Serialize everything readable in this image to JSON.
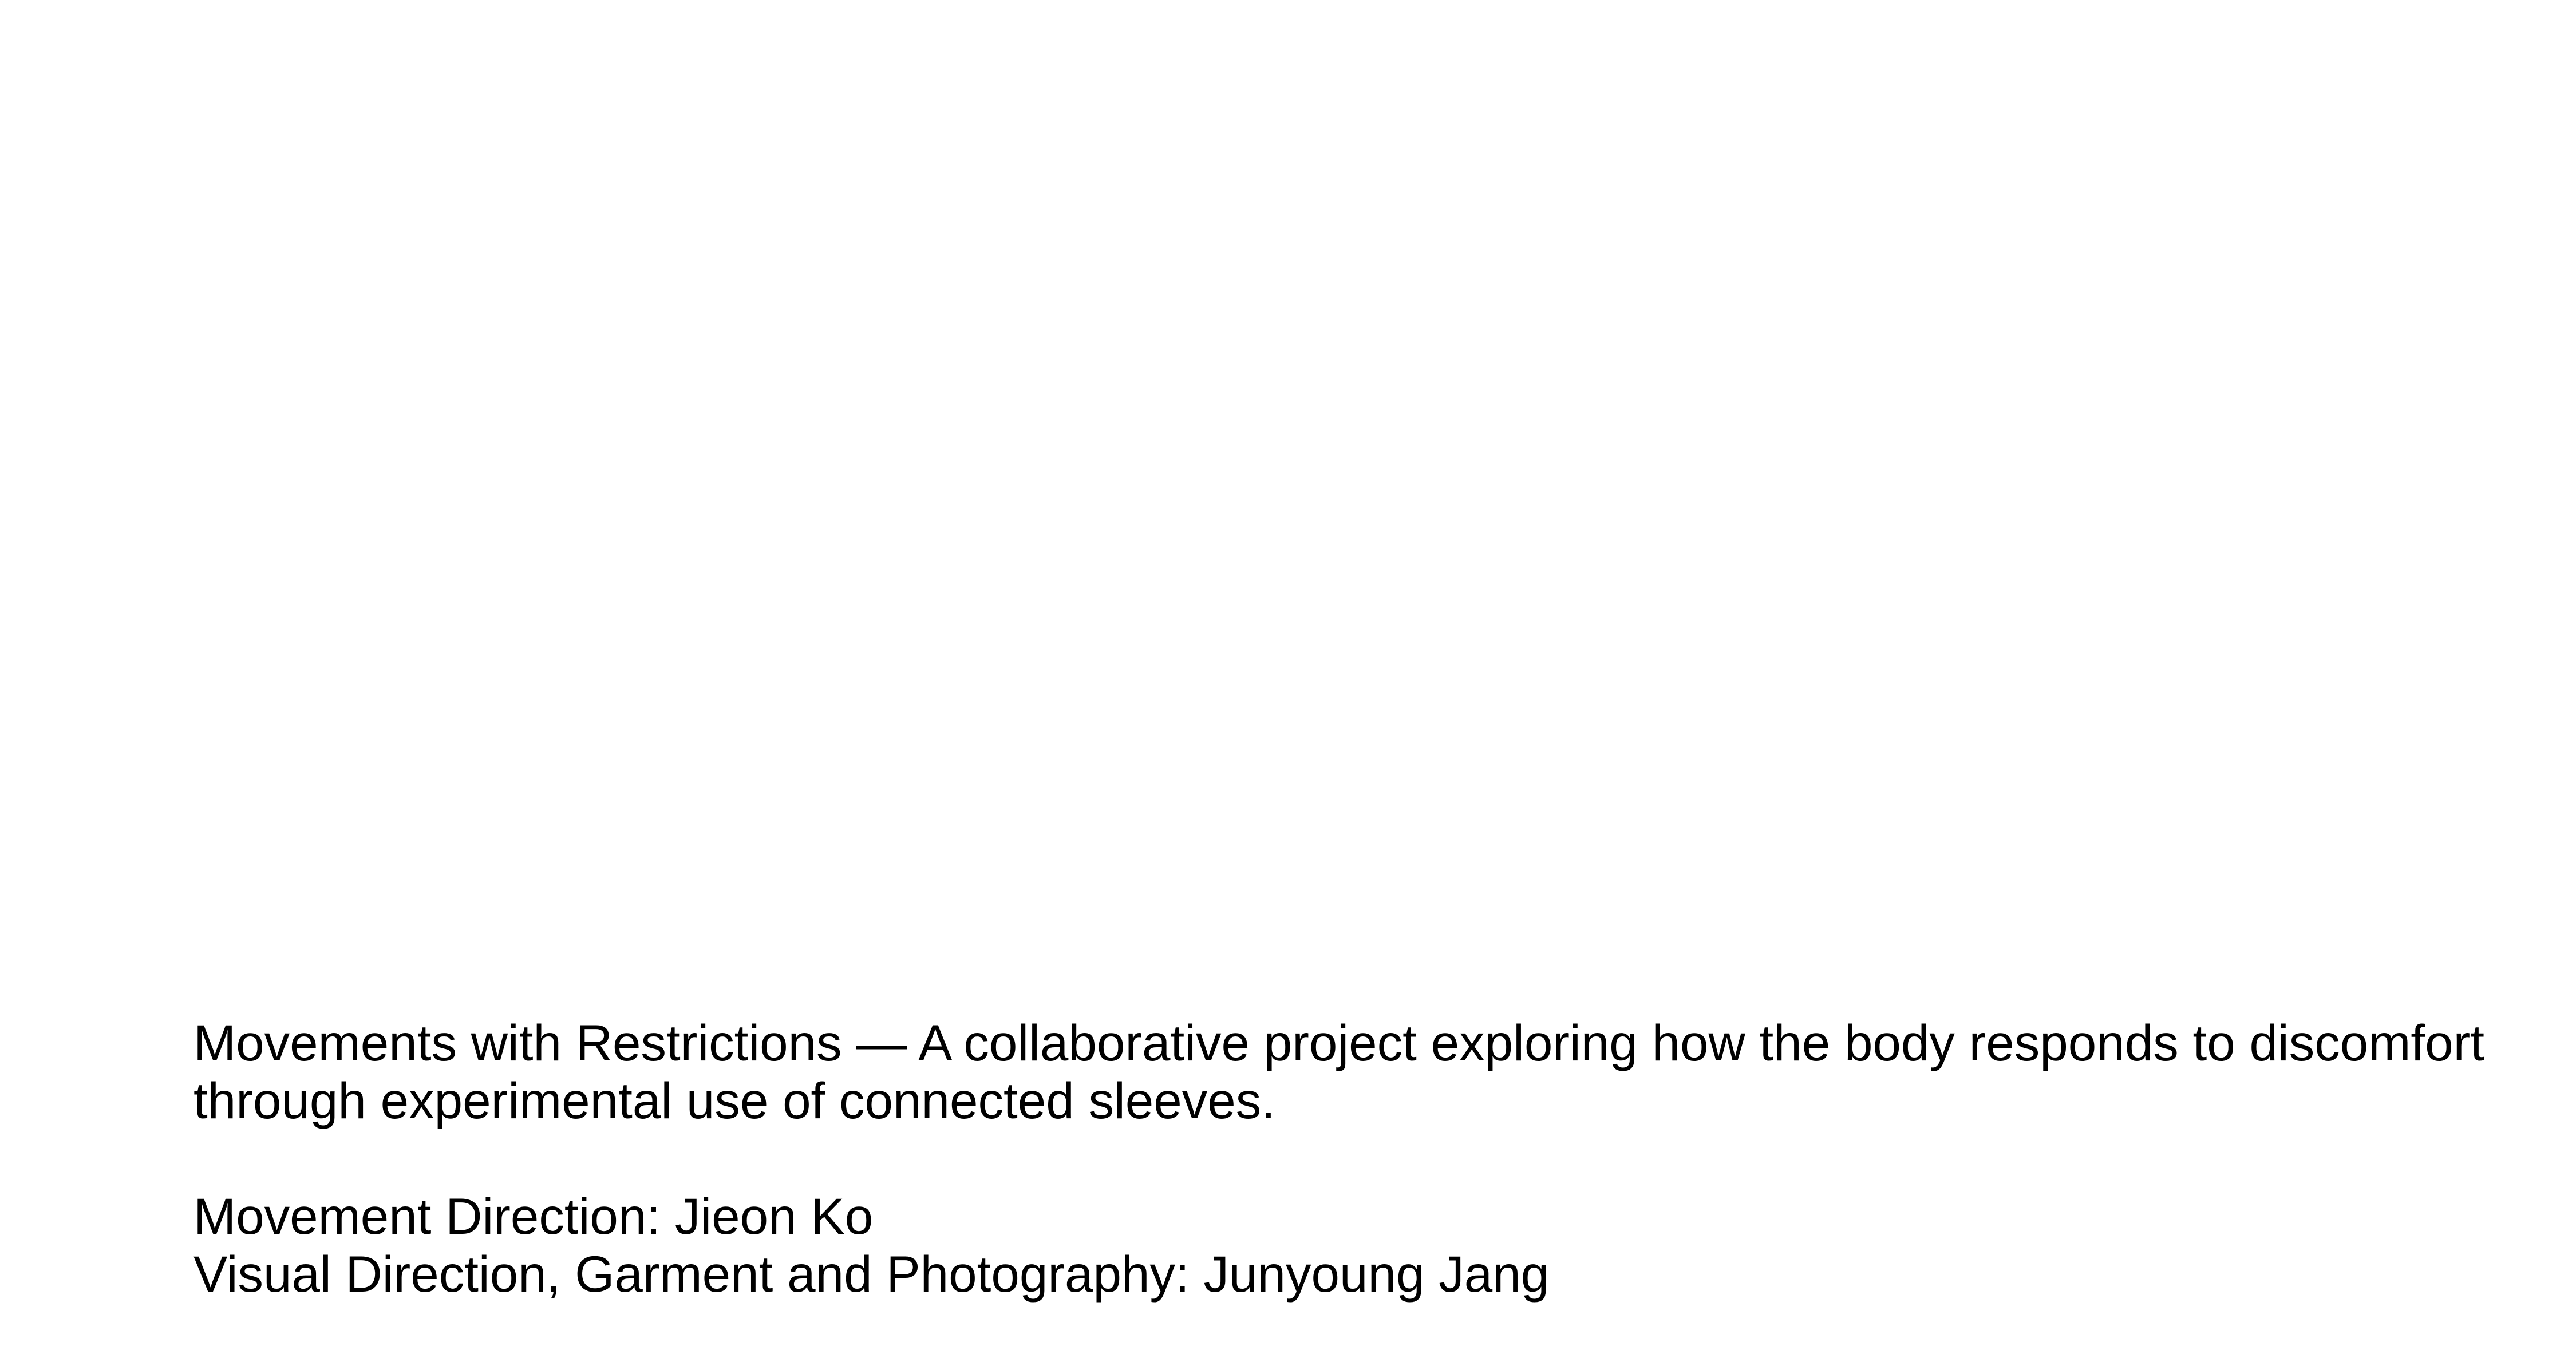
{
  "caption": {
    "description_line_1": "Movements with Restrictions — A collaborative project exploring how the body responds to discomfort",
    "description_line_2": "through experimental use of connected sleeves.",
    "credit_movement": "Movement Direction: Jieon Ko",
    "credit_visual": "Visual Direction, Garment and Photography: Junyoung Jang"
  }
}
